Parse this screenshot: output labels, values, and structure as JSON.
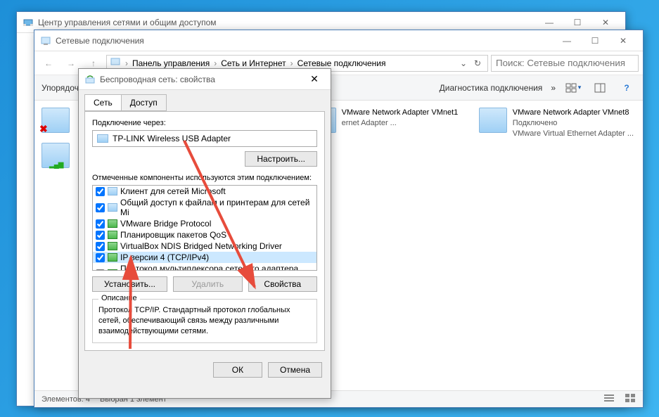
{
  "win1": {
    "title": "Центр управления сетями и общим доступом"
  },
  "win2": {
    "title": "Сетевые подключения",
    "breadcrumb": [
      "Панель управления",
      "Сеть и Интернет",
      "Сетевые подключения"
    ],
    "search_placeholder": "Поиск: Сетевые подключения",
    "commands": {
      "organize": "Упорядочить",
      "diag": "Диагностика подключения",
      "more": "»"
    },
    "adapters": [
      {
        "name": "VMware Network Adapter VMnet1",
        "status": "",
        "desc": "ernet Adapter ..."
      },
      {
        "name": "VMware Network Adapter VMnet8",
        "status": "Подключено",
        "desc": "VMware Virtual Ethernet Adapter ..."
      }
    ],
    "status": {
      "count_label": "Элементов: 4",
      "selected_label": "Выбран 1 элемент"
    }
  },
  "win3": {
    "title": "Беспроводная сеть: свойства",
    "tabs": {
      "network": "Сеть",
      "access": "Доступ"
    },
    "connect_via_label": "Подключение через:",
    "device": "TP-LINK Wireless USB Adapter",
    "configure_btn": "Настроить...",
    "components_label": "Отмеченные компоненты используются этим подключением:",
    "components": [
      {
        "label": "Клиент для сетей Microsoft",
        "checked": true
      },
      {
        "label": "Общий доступ к файлам и принтерам для сетей Mi",
        "checked": true
      },
      {
        "label": "VMware Bridge Protocol",
        "checked": true
      },
      {
        "label": "Планировщик пакетов QoS",
        "checked": true
      },
      {
        "label": "VirtualBox NDIS Bridged Networking Driver",
        "checked": true
      },
      {
        "label": "IP версии 4 (TCP/IPv4)",
        "checked": true,
        "selected": true
      },
      {
        "label": "Протокол мультиплексора сетевого адаптера (Ma",
        "checked": false
      }
    ],
    "install_btn": "Установить...",
    "remove_btn": "Удалить",
    "properties_btn": "Свойства",
    "desc_title": "Описание",
    "desc_text": "Протокол TCP/IP. Стандартный протокол глобальных сетей, обеспечивающий связь между различными взаимодействующими сетями.",
    "ok_btn": "ОК",
    "cancel_btn": "Отмена"
  }
}
